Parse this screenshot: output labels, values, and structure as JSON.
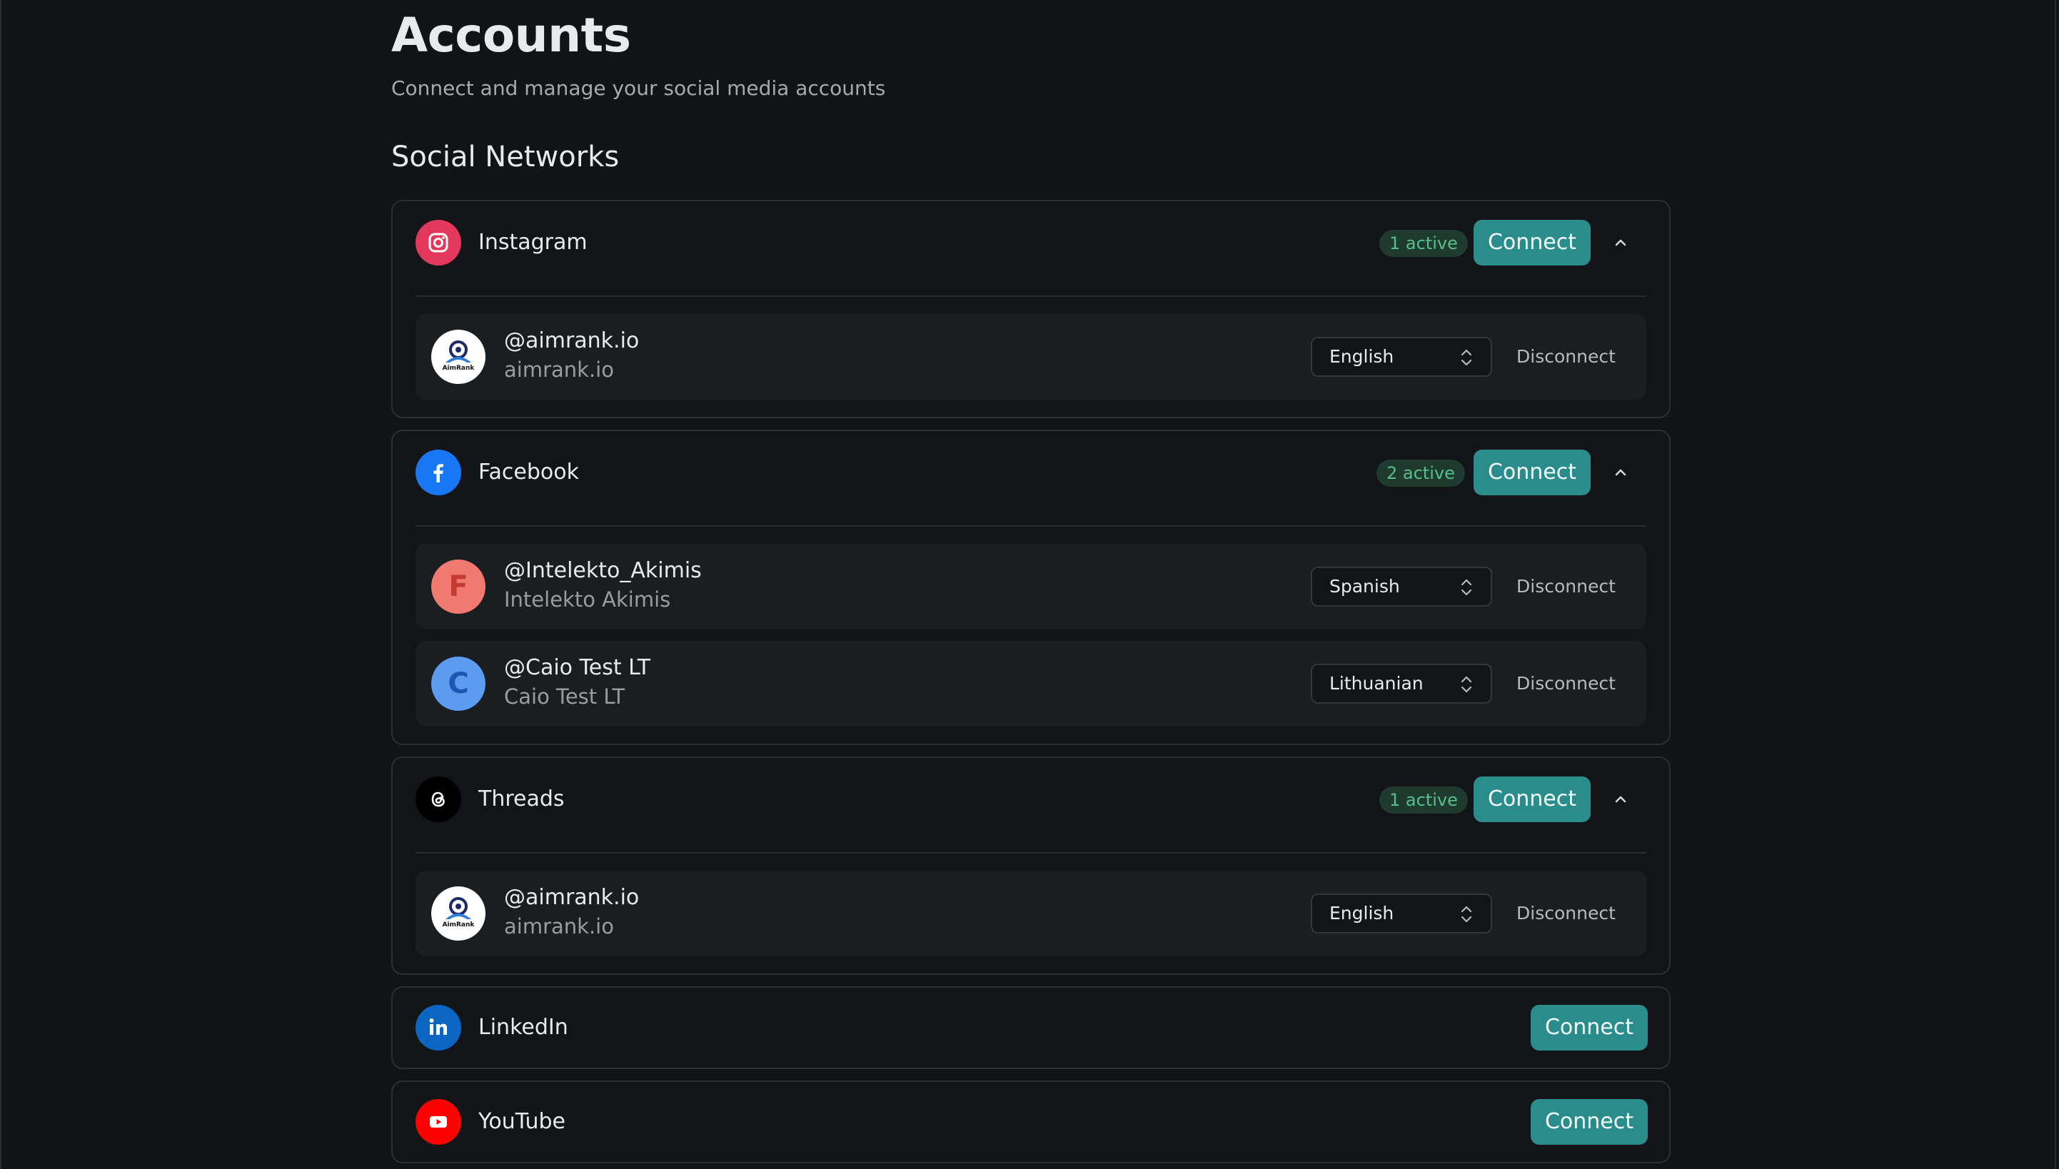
{
  "header": {
    "title": "Accounts",
    "subtitle": "Connect and manage your social media accounts"
  },
  "section": {
    "title": "Social Networks"
  },
  "networks": [
    {
      "name": "Instagram",
      "badge": "1 active",
      "connect_label": "Connect",
      "icon": "instagram-icon",
      "color": "#e3385c",
      "expanded": true,
      "accounts": [
        {
          "handle": "@aimrank.io",
          "name": "aimrank.io",
          "language": "English",
          "disconnect_label": "Disconnect",
          "avatar_text": "AimRank"
        }
      ]
    },
    {
      "name": "Facebook",
      "badge": "2 active",
      "connect_label": "Connect",
      "icon": "facebook-icon",
      "color": "#1877f2",
      "expanded": true,
      "accounts": [
        {
          "handle": "@Intelekto_Akimis",
          "name": "Intelekto Akimis",
          "language": "Spanish",
          "disconnect_label": "Disconnect",
          "avatar_letter": "F",
          "avatar_color": "#f07a70",
          "avatar_text_color": "#c23a30"
        },
        {
          "handle": "@Caio Test LT",
          "name": "Caio Test LT",
          "language": "Lithuanian",
          "disconnect_label": "Disconnect",
          "avatar_letter": "C",
          "avatar_color": "#5b9bf0",
          "avatar_text_color": "#1d56b3"
        }
      ]
    },
    {
      "name": "Threads",
      "badge": "1 active",
      "connect_label": "Connect",
      "icon": "threads-icon",
      "color": "#000000",
      "expanded": true,
      "accounts": [
        {
          "handle": "@aimrank.io",
          "name": "aimrank.io",
          "language": "English",
          "disconnect_label": "Disconnect",
          "avatar_text": "AimRank"
        }
      ]
    },
    {
      "name": "LinkedIn",
      "connect_label": "Connect",
      "icon": "linkedin-icon",
      "color": "#0a66c2",
      "expanded": false
    },
    {
      "name": "YouTube",
      "connect_label": "Connect",
      "icon": "youtube-icon",
      "color": "#ff0000",
      "expanded": false
    }
  ],
  "colors": {
    "background": "#121316",
    "accent": "#2b8c8c",
    "badge_text": "#57c08a",
    "badge_bg": "#1f3a2f"
  }
}
